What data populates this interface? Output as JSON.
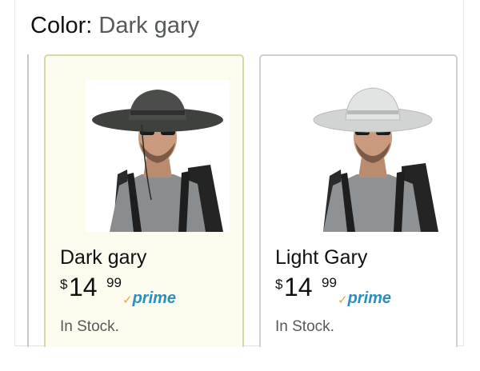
{
  "header": {
    "label": "Color:",
    "value": "Dark gary"
  },
  "options": [
    {
      "name": "Dark gary",
      "price_symbol": "$",
      "price_whole": "14",
      "price_fraction": "99",
      "prime_check": "✓",
      "prime_label": "prime",
      "availability": "In Stock.",
      "selected": true,
      "hat_color": "#4b4d4b"
    },
    {
      "name": "Light Gary",
      "price_symbol": "$",
      "price_whole": "14",
      "price_fraction": "99",
      "prime_check": "✓",
      "prime_label": "prime",
      "availability": "In Stock.",
      "selected": false,
      "hat_color": "#d9dbdb"
    }
  ],
  "colors": {
    "selected_card_bg": "#fdfbee",
    "selected_card_border": "#d4d9a6",
    "card_border": "#cfcfcf",
    "prime_blue": "#2a8fbd",
    "prime_check_orange": "#f0a13a",
    "muted_text": "#565959"
  }
}
